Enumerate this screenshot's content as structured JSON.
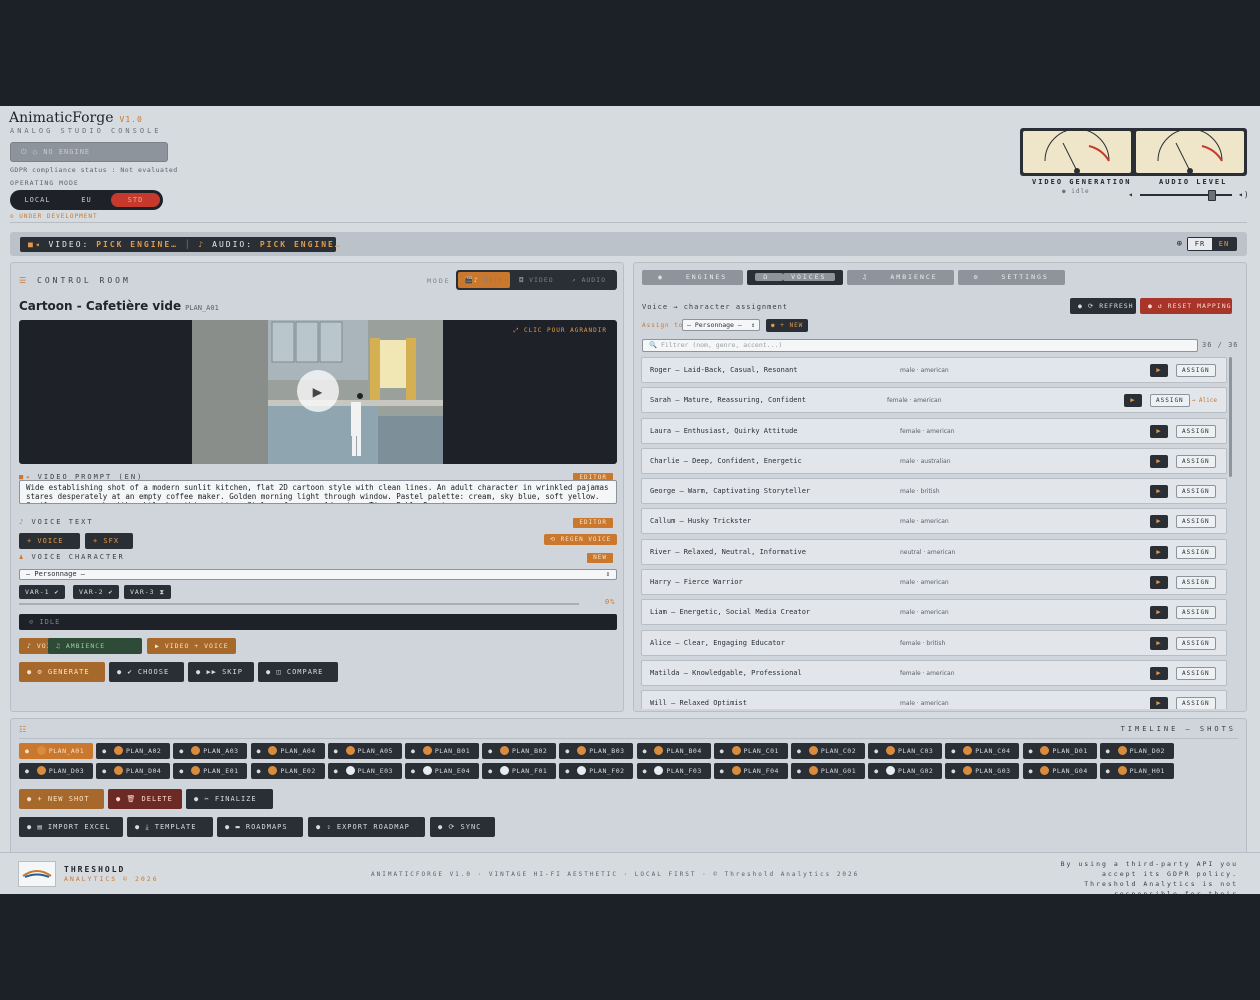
{
  "header": {
    "title": "AnimaticForge",
    "version": "V1.0",
    "subtitle": "ANALOG STUDIO CONSOLE",
    "engine_status": "○ NO ENGINE",
    "gdpr": "GDPR compliance status : Not evaluated",
    "opmode_label": "OPERATING MODE",
    "opmodes": [
      "LOCAL",
      "EU",
      "STD"
    ],
    "opmode_active": "STD",
    "under_dev": "⊙ UNDER DEVELOPMENT",
    "vu1_label": "VIDEO GENERATION",
    "vu1_sub": "● idle",
    "vu2_label": "AUDIO LEVEL",
    "audio_level": 0.8
  },
  "statusbar": {
    "video_label": "VIDEO:",
    "video_value": "PICK ENGINE…",
    "audio_label": "AUDIO:",
    "audio_value": "PICK ENGINE…",
    "lang_fr": "FR",
    "lang_en": "EN"
  },
  "control": {
    "title": "CONTROL ROOM",
    "mode_label": "MODE",
    "modes": [
      "BOTH",
      "VIDEO",
      "AUDIO"
    ],
    "shot_title": "Cartoon - Cafetière vide",
    "shot_id": "PLAN_A01",
    "enlarge": "⤢ CLIC POUR AGRANDIR",
    "prompt_label": "VIDEO PROMPT (EN)",
    "prompt_tag": "EDITOR",
    "prompt_text": "Wide establishing shot of a modern sunlit kitchen, flat 2D cartoon style with clean lines. An adult character in wrinkled pajamas stares desperately at an empty coffee maker. Golden morning light through window. Pastel palette: cream, sky blue, soft yellow. Gentle camera push with subtle breathing motion. Style reference: Adventure Time, Pablo Duarte.",
    "voice_text_label": "VOICE TEXT",
    "voice_text_tag": "EDITOR",
    "add_voice": "+ VOICE",
    "add_sfx": "+ SFX",
    "regen_voice": "⟲ REGEN VOICE",
    "voice_char_label": "VOICE CHARACTER",
    "voice_char_tag": "NEW",
    "voice_char_value": "— Personnage —",
    "variants": [
      "VAR-1",
      "VAR-2",
      "VAR-3"
    ],
    "progress_pct": "0%",
    "idle": "⊙ IDLE",
    "btn_voice": "VOICE",
    "btn_ambience": "AMBIENCE",
    "btn_video_voice": "VIDEO + VOICE",
    "btn_generate": "GENERATE",
    "btn_choose": "CHOOSE",
    "btn_skip": "SKIP",
    "btn_compare": "COMPARE"
  },
  "voices_panel": {
    "tabs": [
      "ENGINES",
      "VOICES",
      "AMBIENCE",
      "SETTINGS"
    ],
    "active_tab": "VOICES",
    "assignment_label": "Voice → character assignment",
    "refresh": "REFRESH",
    "reset": "RESET MAPPING",
    "assign_to": "Assign to:",
    "assign_select": "— Personnage —",
    "new_btn": "+ NEW",
    "filter_placeholder": "Filtrer (nom, genre, accent...)",
    "count": "36 / 36",
    "assign_label": "ASSIGN",
    "voices": [
      {
        "name": "Roger — Laid-Back, Casual, Resonant",
        "meta": "male · american"
      },
      {
        "name": "Sarah — Mature, Reassuring, Confident",
        "meta": "female · american",
        "assigned": "→ Alice"
      },
      {
        "name": "Laura — Enthusiast, Quirky Attitude",
        "meta": "female · american"
      },
      {
        "name": "Charlie — Deep, Confident, Energetic",
        "meta": "male · australian"
      },
      {
        "name": "George — Warm, Captivating Storyteller",
        "meta": "male · british"
      },
      {
        "name": "Callum — Husky Trickster",
        "meta": "male · american"
      },
      {
        "name": "River — Relaxed, Neutral, Informative",
        "meta": "neutral · american"
      },
      {
        "name": "Harry — Fierce Warrior",
        "meta": "male · american"
      },
      {
        "name": "Liam — Energetic, Social Media Creator",
        "meta": "male · american"
      },
      {
        "name": "Alice — Clear, Engaging Educator",
        "meta": "female · british"
      },
      {
        "name": "Matilda — Knowledgable, Professional",
        "meta": "female · american"
      },
      {
        "name": "Will — Relaxed Optimist",
        "meta": "male · american"
      }
    ]
  },
  "timeline": {
    "title": "TIMELINE — SHOTS",
    "shots": [
      {
        "id": "PLAN_A01",
        "active": true,
        "done": false
      },
      {
        "id": "PLAN_A02",
        "done": false
      },
      {
        "id": "PLAN_A03",
        "done": false
      },
      {
        "id": "PLAN_A04",
        "done": false
      },
      {
        "id": "PLAN_A05",
        "done": false
      },
      {
        "id": "PLAN_B01",
        "done": false
      },
      {
        "id": "PLAN_B02",
        "done": false
      },
      {
        "id": "PLAN_B03",
        "done": false
      },
      {
        "id": "PLAN_B04",
        "done": false
      },
      {
        "id": "PLAN_C01",
        "done": false
      },
      {
        "id": "PLAN_C02",
        "done": false
      },
      {
        "id": "PLAN_C03",
        "done": false
      },
      {
        "id": "PLAN_C04",
        "done": false
      },
      {
        "id": "PLAN_D01",
        "done": false
      },
      {
        "id": "PLAN_D02",
        "done": false
      },
      {
        "id": "PLAN_D03",
        "done": false
      },
      {
        "id": "PLAN_D04",
        "done": false
      },
      {
        "id": "PLAN_E01",
        "done": false
      },
      {
        "id": "PLAN_E02",
        "done": false
      },
      {
        "id": "PLAN_E03",
        "done": true
      },
      {
        "id": "PLAN_E04",
        "done": true
      },
      {
        "id": "PLAN_F01",
        "done": true
      },
      {
        "id": "PLAN_F02",
        "done": true
      },
      {
        "id": "PLAN_F03",
        "done": true
      },
      {
        "id": "PLAN_F04",
        "done": false
      },
      {
        "id": "PLAN_G01",
        "done": false
      },
      {
        "id": "PLAN_G02",
        "done": true
      },
      {
        "id": "PLAN_G03",
        "done": false
      },
      {
        "id": "PLAN_G04",
        "done": false
      },
      {
        "id": "PLAN_H01",
        "done": false
      }
    ],
    "new_shot": "+ NEW SHOT",
    "delete": "DELETE",
    "finalize": "FINALIZE",
    "import_excel": "IMPORT EXCEL",
    "template": "TEMPLATE",
    "roadmaps": "ROADMAPS",
    "export_roadmap": "EXPORT ROADMAP",
    "sync": "SYNC"
  },
  "footer": {
    "brand": "THRESHOLD",
    "brand_sub": "ANALYTICS © 2026",
    "center": "ANIMATICFORGE V1.0 · VINTAGE HI-FI AESTHETIC · LOCAL FIRST · © Threshold Analytics 2026",
    "right": "By using a third-party API you accept its GDPR policy. Threshold Analytics is not responsible for their compliance."
  },
  "colors": {
    "accent": "#c9782e",
    "danger": "#a8352a",
    "dark": "#2a2f36",
    "panel": "#d0d5db"
  }
}
